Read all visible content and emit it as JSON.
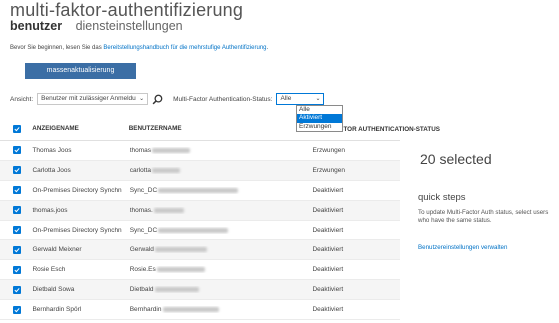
{
  "header": {
    "title": "multi-faktor-authentifizierung",
    "tabs": [
      {
        "label": "benutzer",
        "active": true
      },
      {
        "label": "diensteinstellungen",
        "active": false
      }
    ]
  },
  "intro": {
    "text_before": "Bevor Sie beginnen, lesen Sie das ",
    "link": "Bereitstellungshandbuch für die mehrstufige Authentifizierung",
    "text_after": "."
  },
  "toolbar": {
    "mass_update_label": "massenaktualisierung",
    "view_label": "Ansicht:",
    "view_value": "Benutzer mit zulässiger Anmeldu",
    "status_label": "Multi-Factor Authentication-Status:",
    "status_value": "Alle",
    "status_options": [
      "Alle",
      "Aktiviert",
      "Erzwungen"
    ],
    "status_highlighted": "Aktiviert"
  },
  "table": {
    "columns": [
      "ANZEIGENAME",
      "BENUTZERNAME",
      "MULTI-FACTOR AUTHENTICATION-STATUS"
    ],
    "rows": [
      {
        "name": "Thomas Joos",
        "user": "thomas",
        "status": "Erzwungen"
      },
      {
        "name": "Carlotta Joos",
        "user": "carlotta",
        "status": "Erzwungen"
      },
      {
        "name": "On-Premises Directory Synchn",
        "user": "Sync_DC",
        "status": "Deaktiviert"
      },
      {
        "name": "thomas.joos",
        "user": "thomas.",
        "status": "Deaktiviert"
      },
      {
        "name": "On-Premises Directory Synchn",
        "user": "Sync_DC",
        "status": "Deaktiviert"
      },
      {
        "name": "Gerwald Meixner",
        "user": "Gerwald",
        "status": "Deaktiviert"
      },
      {
        "name": "Rosie Esch",
        "user": "Rosie.Es",
        "status": "Deaktiviert"
      },
      {
        "name": "Dietbald Sowa",
        "user": "Dietbald",
        "status": "Deaktiviert"
      },
      {
        "name": "Bernhardin Spörl",
        "user": "Bernhardin",
        "status": "Deaktiviert"
      }
    ]
  },
  "side_panel": {
    "selected": "20 selected",
    "quick_steps_title": "quick steps",
    "quick_steps_text": "To update Multi-Factor Auth status, select users who have the same status.",
    "settings_link": "Benutzereinstellungen verwalten"
  },
  "colors": {
    "accent": "#0078d7",
    "button": "#3b6ea5",
    "link": "#0072c6"
  }
}
